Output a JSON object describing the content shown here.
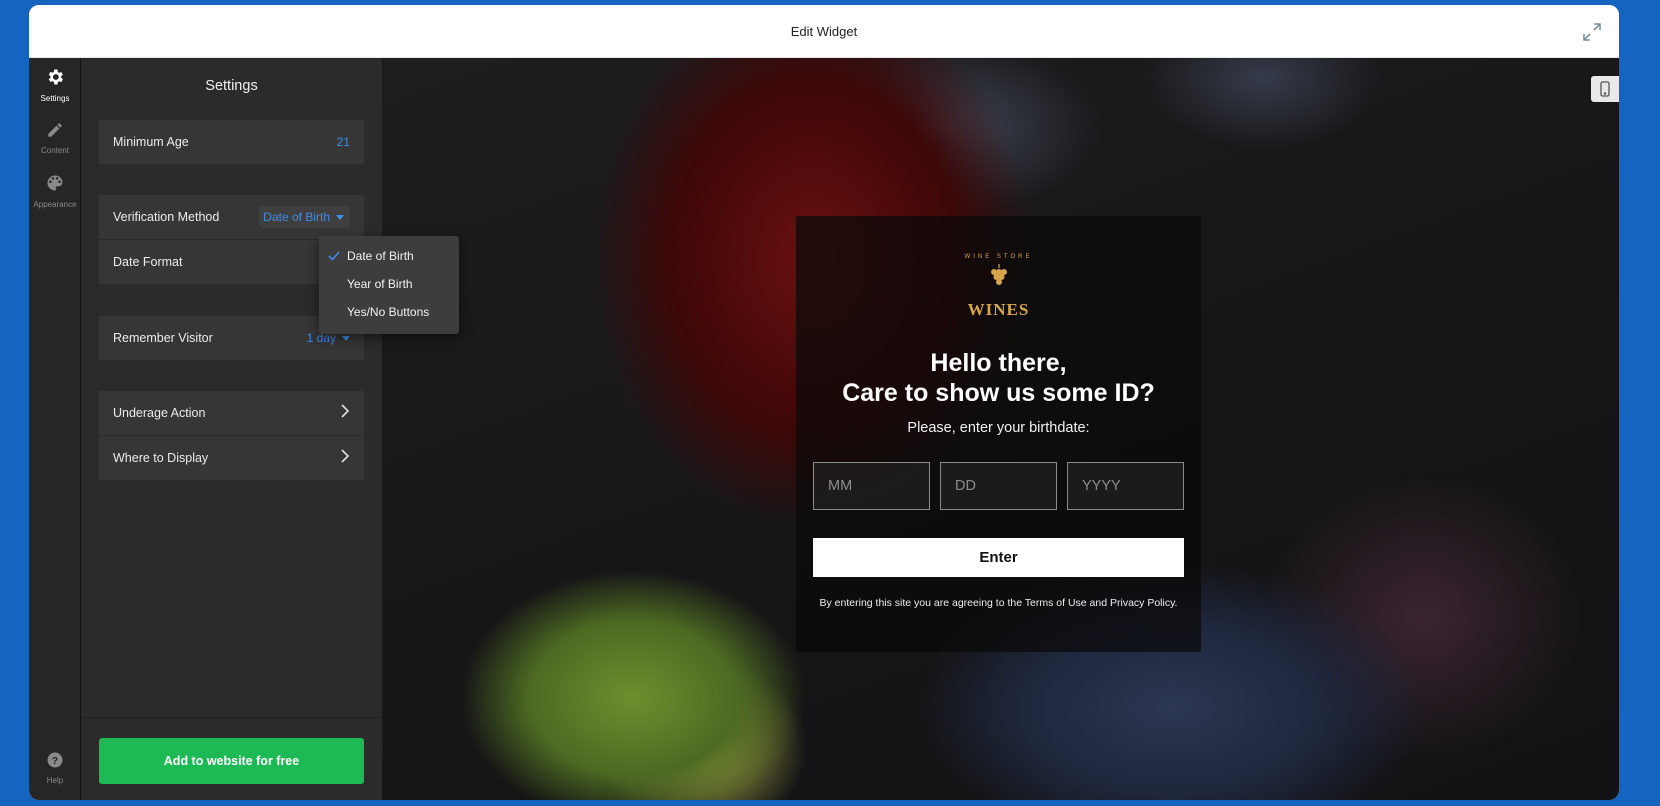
{
  "window": {
    "title": "Edit Widget"
  },
  "rail": {
    "items": [
      {
        "label": "Settings",
        "icon": "gear-icon",
        "active": true
      },
      {
        "label": "Content",
        "icon": "pencil-icon",
        "active": false
      },
      {
        "label": "Appearance",
        "icon": "palette-icon",
        "active": false
      }
    ],
    "help_label": "Help"
  },
  "panel": {
    "title": "Settings",
    "minimum_age": {
      "label": "Minimum Age",
      "value": "21"
    },
    "verification_method": {
      "label": "Verification Method",
      "value": "Date of Birth"
    },
    "date_format": {
      "label": "Date Format"
    },
    "remember_visitor": {
      "label": "Remember Visitor",
      "value": "1 day"
    },
    "underage_action": {
      "label": "Underage Action"
    },
    "where_to_display": {
      "label": "Where to Display"
    },
    "dropdown": {
      "options": [
        "Date of Birth",
        "Year of Birth",
        "Yes/No Buttons"
      ],
      "selected": "Date of Birth"
    },
    "cta_label": "Add to website for free"
  },
  "preview": {
    "logo": {
      "arc_text": "WINE STORE",
      "word": "WINES"
    },
    "headline_line1": "Hello there,",
    "headline_line2": "Care to show us some ID?",
    "subtitle": "Please, enter your birthdate:",
    "inputs": {
      "month_placeholder": "MM",
      "day_placeholder": "DD",
      "year_placeholder": "YYYY"
    },
    "enter_label": "Enter",
    "legal_text": "By entering this site you are agreeing to the Terms of Use and Privacy Policy."
  },
  "colors": {
    "accent": "#3d8eea",
    "cta": "#1db954",
    "logo_gold": "#d8a64a",
    "page_bg": "#1565c0"
  }
}
